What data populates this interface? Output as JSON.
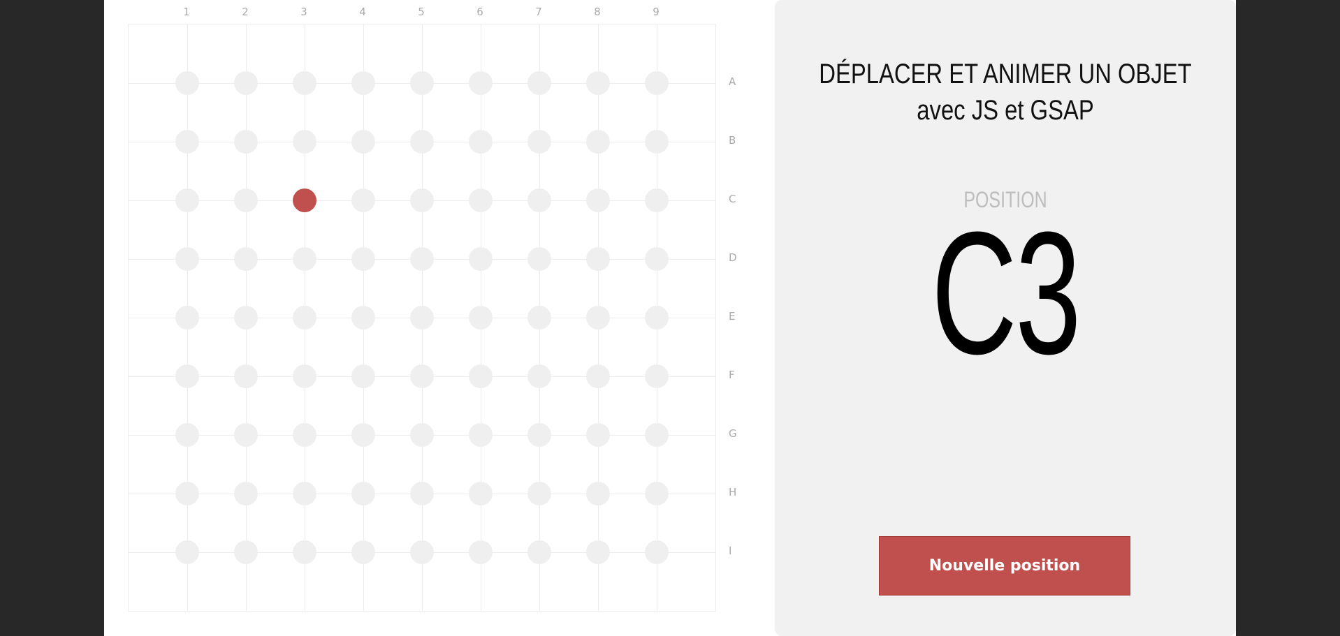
{
  "board": {
    "columns": [
      "1",
      "2",
      "3",
      "4",
      "5",
      "6",
      "7",
      "8",
      "9"
    ],
    "rows": [
      "A",
      "B",
      "C",
      "D",
      "E",
      "F",
      "G",
      "H",
      "I"
    ],
    "active_row": "C",
    "active_column": "3",
    "dot_color": "#efefef",
    "active_color": "#c0504d"
  },
  "panel": {
    "title_line1": "DÉPLACER ET ANIMER UN OBJET",
    "title_line2": "avec JS et GSAP",
    "position_label": "POSITION",
    "position_value": "C3",
    "button_label": "Nouvelle position"
  }
}
